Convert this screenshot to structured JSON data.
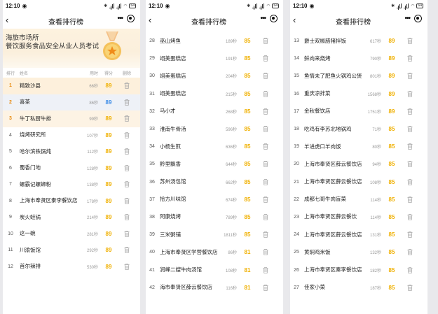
{
  "nav_title": "查看排行榜",
  "status_time": "12:10",
  "battery": "64",
  "banner": {
    "line1": "海旅市场所",
    "line2": "餐饮服务食品安全从业人员考试"
  },
  "headers": {
    "rank": "排行",
    "name": "姓名",
    "time": "用时",
    "score": "得分",
    "del": "删除"
  },
  "colors": {
    "gold": "#f0b000",
    "blue": "#3c8ce7",
    "rank1_bg": "#fdf0dc",
    "rank2_bg": "#eef1f7",
    "rank3_bg": "#fdf3e4"
  },
  "panels": [
    {
      "rows": [
        {
          "rank": "1",
          "name": "精致沙县",
          "time": "66秒",
          "score": "89"
        },
        {
          "rank": "2",
          "name": "喜茶",
          "time": "86秒",
          "score": "89"
        },
        {
          "rank": "3",
          "name": "牛丁私厨牛排",
          "time": "99秒",
          "score": "89"
        },
        {
          "rank": "4",
          "name": "烧烤研究所",
          "time": "107秒",
          "score": "89"
        },
        {
          "rank": "5",
          "name": "哈尔滨铁锅炖",
          "time": "112秒",
          "score": "89"
        },
        {
          "rank": "6",
          "name": "蜀香门地",
          "time": "128秒",
          "score": "89"
        },
        {
          "rank": "7",
          "name": "螺霸记螺蛳粉",
          "time": "138秒",
          "score": "89"
        },
        {
          "rank": "8",
          "name": "上海市奉贤区秦李餐饮店",
          "time": "178秒",
          "score": "89"
        },
        {
          "rank": "9",
          "name": "炭火蛙锅",
          "time": "214秒",
          "score": "89"
        },
        {
          "rank": "10",
          "name": "这一碗",
          "time": "281秒",
          "score": "89"
        },
        {
          "rank": "11",
          "name": "川渝饭馆",
          "time": "292秒",
          "score": "89"
        },
        {
          "rank": "12",
          "name": "首尔辣排",
          "time": "530秒",
          "score": "89"
        }
      ]
    },
    {
      "rows": [
        {
          "rank": "28",
          "name": "巫山烤鱼",
          "time": "189秒",
          "score": "85"
        },
        {
          "rank": "29",
          "name": "翊美蛋糕店",
          "time": "191秒",
          "score": "85"
        },
        {
          "rank": "30",
          "name": "翊美蛋糕店",
          "time": "204秒",
          "score": "85"
        },
        {
          "rank": "31",
          "name": "翊美蛋糕店",
          "time": "215秒",
          "score": "85"
        },
        {
          "rank": "32",
          "name": "马小才",
          "time": "268秒",
          "score": "85"
        },
        {
          "rank": "33",
          "name": "淮南牛骨汤",
          "time": "596秒",
          "score": "85"
        },
        {
          "rank": "34",
          "name": "小杨生煎",
          "time": "636秒",
          "score": "85"
        },
        {
          "rank": "35",
          "name": "黔里飘香",
          "time": "644秒",
          "score": "85"
        },
        {
          "rank": "36",
          "name": "苏州汤包馆",
          "time": "662秒",
          "score": "85"
        },
        {
          "rank": "37",
          "name": "拾方川味馆",
          "time": "674秒",
          "score": "85"
        },
        {
          "rank": "38",
          "name": "阿康烧烤",
          "time": "789秒",
          "score": "85"
        },
        {
          "rank": "39",
          "name": "三米粥铺",
          "time": "1811秒",
          "score": "85"
        },
        {
          "rank": "40",
          "name": "上海市奉贤区学营餐饮店",
          "time": "86秒",
          "score": "81"
        },
        {
          "rank": "41",
          "name": "润峰二嫂牛肉汤馆",
          "time": "108秒",
          "score": "81"
        },
        {
          "rank": "42",
          "name": "海市奉贤区薛云餐饮店",
          "time": "116秒",
          "score": "81"
        }
      ]
    },
    {
      "rows": [
        {
          "rank": "13",
          "name": "爵士双椒腊猪拌饭",
          "time": "617秒",
          "score": "89"
        },
        {
          "rank": "14",
          "name": "鲜肉来烧烤",
          "time": "790秒",
          "score": "89"
        },
        {
          "rank": "15",
          "name": "鱼情未了肥鱼火锅鸡公煲",
          "time": "801秒",
          "score": "89"
        },
        {
          "rank": "16",
          "name": "重庆凉拌菜",
          "time": "1568秒",
          "score": "89"
        },
        {
          "rank": "17",
          "name": "金秋餐饮店",
          "time": "1751秒",
          "score": "89"
        },
        {
          "rank": "18",
          "name": "吃鸡有李苏北地锅鸡",
          "time": "71秒",
          "score": "85"
        },
        {
          "rank": "19",
          "name": "羊进虎口羊肉饭",
          "time": "80秒",
          "score": "85"
        },
        {
          "rank": "20",
          "name": "上海市奉贤区薛云餐饮店",
          "time": "94秒",
          "score": "85"
        },
        {
          "rank": "21",
          "name": "上海市奉贤区薛云餐饮店",
          "time": "108秒",
          "score": "85"
        },
        {
          "rank": "22",
          "name": "成都七哥牛肉盲菜",
          "time": "114秒",
          "score": "85"
        },
        {
          "rank": "23",
          "name": "上海市奉贤区薛云餐饮",
          "time": "114秒",
          "score": "85"
        },
        {
          "rank": "24",
          "name": "上海市奉贤区薛云餐饮店",
          "time": "131秒",
          "score": "85"
        },
        {
          "rank": "25",
          "name": "黄焖鸡米饭",
          "time": "132秒",
          "score": "85"
        },
        {
          "rank": "26",
          "name": "上海市奉贤区秦李餐饮店",
          "time": "182秒",
          "score": "85"
        },
        {
          "rank": "27",
          "name": "佳家小菜",
          "time": "187秒",
          "score": "85"
        }
      ]
    }
  ]
}
